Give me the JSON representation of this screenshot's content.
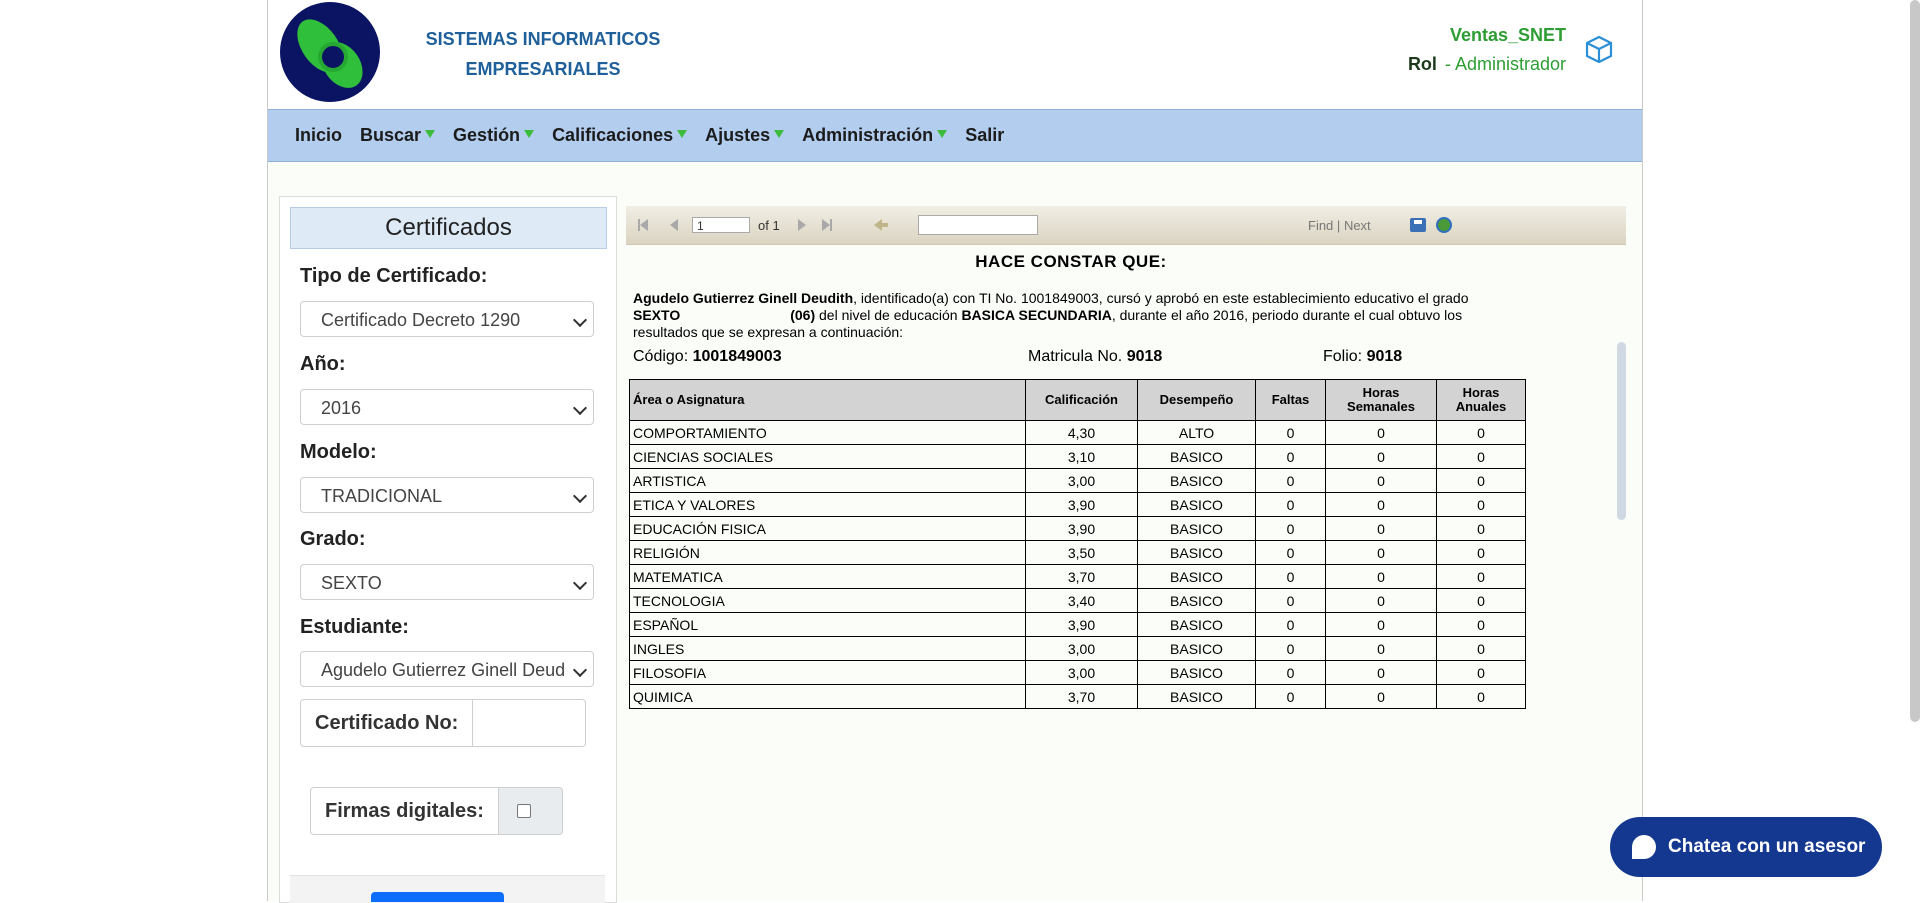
{
  "header": {
    "company_line1": "SISTEMAS INFORMATICOS",
    "company_line2": "EMPRESARIALES",
    "app_name": "Ventas_SNET",
    "role_label": "Rol",
    "role_sep": "-",
    "role_value": "Administrador",
    "cube_icon": "cube-icon"
  },
  "nav": {
    "items": [
      {
        "label": "Inicio",
        "dropdown": false
      },
      {
        "label": "Buscar",
        "dropdown": true
      },
      {
        "label": "Gestión",
        "dropdown": true
      },
      {
        "label": "Calificaciones",
        "dropdown": true
      },
      {
        "label": "Ajustes",
        "dropdown": true
      },
      {
        "label": "Administración",
        "dropdown": true
      },
      {
        "label": "Salir",
        "dropdown": false
      }
    ]
  },
  "sidebar": {
    "title": "Certificados",
    "tipo_label": "Tipo de Certificado:",
    "tipo_value": "Certificado Decreto 1290",
    "anio_label": "Año:",
    "anio_value": "2016",
    "modelo_label": "Modelo:",
    "modelo_value": "TRADICIONAL",
    "grado_label": "Grado:",
    "grado_value": "SEXTO",
    "estudiante_label": "Estudiante:",
    "estudiante_value": "Agudelo Gutierrez Ginell Deud",
    "cert_no_label": "Certificado No:",
    "firmas_label": "Firmas digitales:"
  },
  "toolbar": {
    "page_value": "1",
    "of_label": "of 1",
    "find_label": "Find",
    "sep": "|",
    "next_label": "Next"
  },
  "report": {
    "title": "HACE CONSTAR QUE:",
    "student_name": "Agudelo Gutierrez Ginell Deudith",
    "para_part1": ", identificado(a) con TI No. 1001849003, cursó y aprobó en este establecimiento educativo el grado ",
    "grade_name": "SEXTO",
    "grade_code": "(06)",
    "para_part2": " del nivel de educación ",
    "level": "BASICA SECUNDARIA",
    "para_part3": ", durante el año  2016, periodo  durante  el cual obtuvo los resultados  que se expresan  a  continuación:",
    "codigo_label": "Código:",
    "codigo_value": "1001849003",
    "matricula_label": "Matricula No.",
    "matricula_value": "9018",
    "folio_label": "Folio:",
    "folio_value": "9018",
    "columns": [
      "Área o Asignatura",
      "Calificación",
      "Desempeño",
      "Faltas",
      "Horas Semanales",
      "Horas Anuales"
    ],
    "rows": [
      [
        "COMPORTAMIENTO",
        "4,30",
        "ALTO",
        "0",
        "0",
        "0"
      ],
      [
        "CIENCIAS SOCIALES",
        "3,10",
        "BASICO",
        "0",
        "0",
        "0"
      ],
      [
        "ARTISTICA",
        "3,00",
        "BASICO",
        "0",
        "0",
        "0"
      ],
      [
        "ETICA Y VALORES",
        "3,90",
        "BASICO",
        "0",
        "0",
        "0"
      ],
      [
        "EDUCACIÓN FISICA",
        "3,90",
        "BASICO",
        "0",
        "0",
        "0"
      ],
      [
        "RELIGIÓN",
        "3,50",
        "BASICO",
        "0",
        "0",
        "0"
      ],
      [
        "MATEMATICA",
        "3,70",
        "BASICO",
        "0",
        "0",
        "0"
      ],
      [
        "TECNOLOGIA",
        "3,40",
        "BASICO",
        "0",
        "0",
        "0"
      ],
      [
        "ESPAÑOL",
        "3,90",
        "BASICO",
        "0",
        "0",
        "0"
      ],
      [
        "INGLES",
        "3,00",
        "BASICO",
        "0",
        "0",
        "0"
      ],
      [
        "FILOSOFIA",
        "3,00",
        "BASICO",
        "0",
        "0",
        "0"
      ],
      [
        "QUIMICA",
        "3,70",
        "BASICO",
        "0",
        "0",
        "0"
      ]
    ]
  },
  "chat": {
    "label": "Chatea con un asesor"
  },
  "colors": {
    "nav_bg": "#b3cdef",
    "brand_blue": "#1f5f9a",
    "brand_green": "#2e9e34",
    "chat_bg": "#14378f"
  }
}
